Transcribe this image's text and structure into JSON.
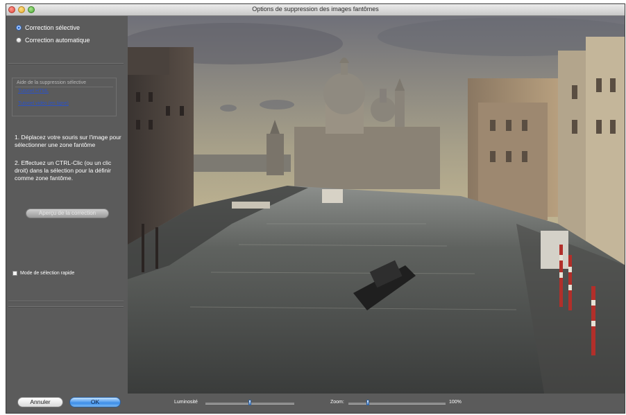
{
  "window": {
    "title": "Options de suppression des images fantômes"
  },
  "sidebar": {
    "modes": [
      {
        "label": "Correction sélective",
        "selected": true
      },
      {
        "label": "Correction automatique",
        "selected": false
      }
    ],
    "help": {
      "title": "Aide de la suppression sélective",
      "links": [
        "Tutoriel HTML",
        "Tutoriel vidéo (en ligne)"
      ]
    },
    "instructions": [
      "1. Déplacez votre souris sur l'image pour sélectionner une zone fantôme",
      "2. Effectuez un CTRL-Clic (ou un clic droit) dans la sélection pour la définir comme zone fantôme."
    ],
    "preview_button": "Aperçu de la correction",
    "quick_select_label": "Mode de sélection rapide",
    "quick_select_checked": false
  },
  "buttons": {
    "cancel": "Annuler",
    "ok": "OK"
  },
  "controls": {
    "brightness_label": "Luminosité",
    "brightness_level": 0.5,
    "zoom_label": "Zoom:",
    "zoom_level": 0.2,
    "zoom_value": "100%"
  },
  "colors": {
    "panel": "#5b5b5b",
    "ok_accent": "#3d8ee8",
    "link": "#2a52c9"
  }
}
